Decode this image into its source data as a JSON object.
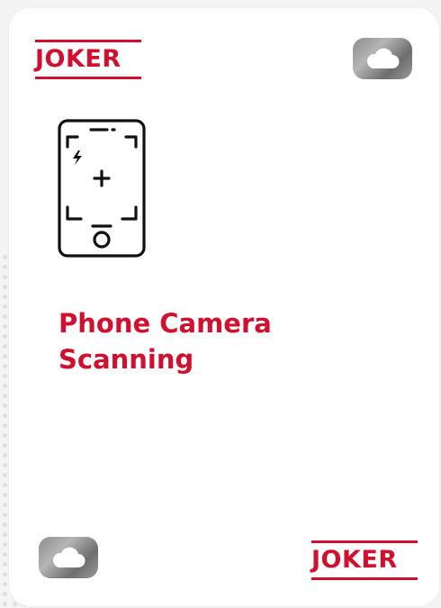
{
  "card": {
    "brand_top": "JOKER",
    "brand_bottom": "JOKER",
    "title_lines": [
      "Phone Camera",
      "Scanning"
    ],
    "icons": {
      "main": "phone-camera-scan-icon",
      "corner_top": "cloud-icon",
      "corner_bottom": "cloud-icon"
    }
  },
  "colors": {
    "accent": "#d0102e",
    "badge": "#8c8c8c",
    "icon_stroke": "#111111"
  }
}
